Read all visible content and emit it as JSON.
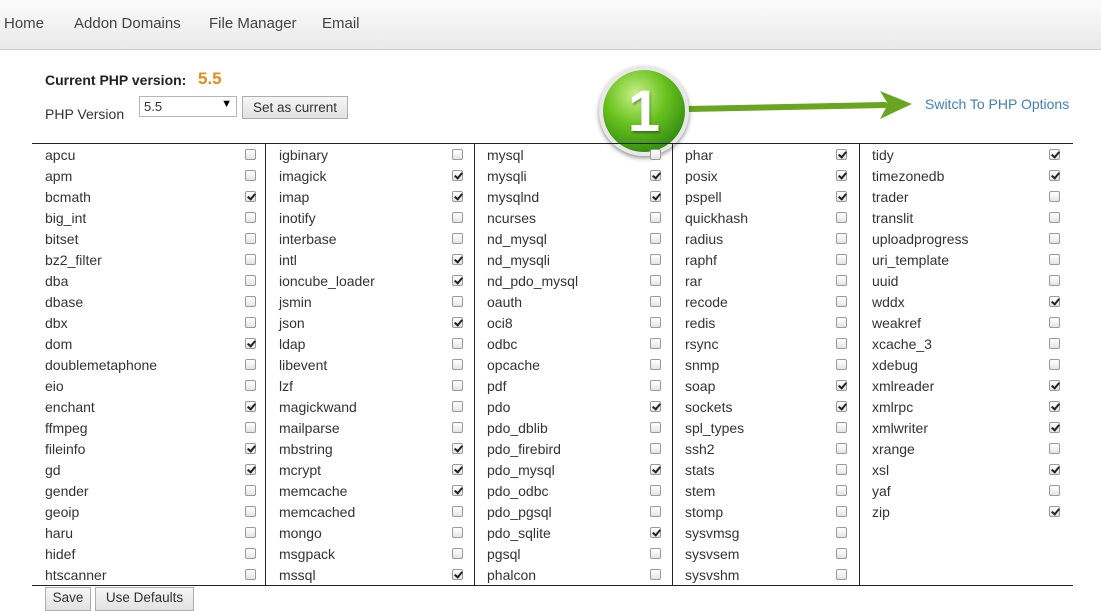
{
  "nav": {
    "items": [
      "Home",
      "Addon Domains",
      "File Manager",
      "Email"
    ]
  },
  "php": {
    "current_label": "Current PHP version:",
    "current_value": "5.5",
    "version_label": "PHP Version",
    "version_selected": "5.5",
    "set_current_label": "Set as current",
    "switch_link": "Switch To PHP Options",
    "annotation_badge": "1"
  },
  "colors": {
    "accent_orange": "#e98a1a",
    "link_blue": "#3d7fc0",
    "badge_green": "#6ac21e",
    "arrow_green": "#6aa521"
  },
  "columns": [
    [
      {
        "name": "apcu",
        "checked": false
      },
      {
        "name": "apm",
        "checked": false
      },
      {
        "name": "bcmath",
        "checked": true
      },
      {
        "name": "big_int",
        "checked": false
      },
      {
        "name": "bitset",
        "checked": false
      },
      {
        "name": "bz2_filter",
        "checked": false
      },
      {
        "name": "dba",
        "checked": false
      },
      {
        "name": "dbase",
        "checked": false
      },
      {
        "name": "dbx",
        "checked": false
      },
      {
        "name": "dom",
        "checked": true
      },
      {
        "name": "doublemetaphone",
        "checked": false
      },
      {
        "name": "eio",
        "checked": false
      },
      {
        "name": "enchant",
        "checked": true
      },
      {
        "name": "ffmpeg",
        "checked": false
      },
      {
        "name": "fileinfo",
        "checked": true
      },
      {
        "name": "gd",
        "checked": true
      },
      {
        "name": "gender",
        "checked": false
      },
      {
        "name": "geoip",
        "checked": false
      },
      {
        "name": "haru",
        "checked": false
      },
      {
        "name": "hidef",
        "checked": false
      },
      {
        "name": "htscanner",
        "checked": false
      }
    ],
    [
      {
        "name": "igbinary",
        "checked": false
      },
      {
        "name": "imagick",
        "checked": true
      },
      {
        "name": "imap",
        "checked": true
      },
      {
        "name": "inotify",
        "checked": false
      },
      {
        "name": "interbase",
        "checked": false
      },
      {
        "name": "intl",
        "checked": true
      },
      {
        "name": "ioncube_loader",
        "checked": true
      },
      {
        "name": "jsmin",
        "checked": false
      },
      {
        "name": "json",
        "checked": true
      },
      {
        "name": "ldap",
        "checked": false
      },
      {
        "name": "libevent",
        "checked": false
      },
      {
        "name": "lzf",
        "checked": false
      },
      {
        "name": "magickwand",
        "checked": false
      },
      {
        "name": "mailparse",
        "checked": false
      },
      {
        "name": "mbstring",
        "checked": true
      },
      {
        "name": "mcrypt",
        "checked": true
      },
      {
        "name": "memcache",
        "checked": true
      },
      {
        "name": "memcached",
        "checked": false
      },
      {
        "name": "mongo",
        "checked": false
      },
      {
        "name": "msgpack",
        "checked": false
      },
      {
        "name": "mssql",
        "checked": true
      }
    ],
    [
      {
        "name": "mysql",
        "checked": false
      },
      {
        "name": "mysqli",
        "checked": true
      },
      {
        "name": "mysqlnd",
        "checked": true
      },
      {
        "name": "ncurses",
        "checked": false
      },
      {
        "name": "nd_mysql",
        "checked": false
      },
      {
        "name": "nd_mysqli",
        "checked": false
      },
      {
        "name": "nd_pdo_mysql",
        "checked": false
      },
      {
        "name": "oauth",
        "checked": false
      },
      {
        "name": "oci8",
        "checked": false
      },
      {
        "name": "odbc",
        "checked": false
      },
      {
        "name": "opcache",
        "checked": false
      },
      {
        "name": "pdf",
        "checked": false
      },
      {
        "name": "pdo",
        "checked": true
      },
      {
        "name": "pdo_dblib",
        "checked": false
      },
      {
        "name": "pdo_firebird",
        "checked": false
      },
      {
        "name": "pdo_mysql",
        "checked": true
      },
      {
        "name": "pdo_odbc",
        "checked": false
      },
      {
        "name": "pdo_pgsql",
        "checked": false
      },
      {
        "name": "pdo_sqlite",
        "checked": true
      },
      {
        "name": "pgsql",
        "checked": false
      },
      {
        "name": "phalcon",
        "checked": false
      }
    ],
    [
      {
        "name": "phar",
        "checked": true
      },
      {
        "name": "posix",
        "checked": true
      },
      {
        "name": "pspell",
        "checked": true
      },
      {
        "name": "quickhash",
        "checked": false
      },
      {
        "name": "radius",
        "checked": false
      },
      {
        "name": "raphf",
        "checked": false
      },
      {
        "name": "rar",
        "checked": false
      },
      {
        "name": "recode",
        "checked": false
      },
      {
        "name": "redis",
        "checked": false
      },
      {
        "name": "rsync",
        "checked": false
      },
      {
        "name": "snmp",
        "checked": false
      },
      {
        "name": "soap",
        "checked": true
      },
      {
        "name": "sockets",
        "checked": true
      },
      {
        "name": "spl_types",
        "checked": false
      },
      {
        "name": "ssh2",
        "checked": false
      },
      {
        "name": "stats",
        "checked": false
      },
      {
        "name": "stem",
        "checked": false
      },
      {
        "name": "stomp",
        "checked": false
      },
      {
        "name": "sysvmsg",
        "checked": false
      },
      {
        "name": "sysvsem",
        "checked": false
      },
      {
        "name": "sysvshm",
        "checked": false
      }
    ],
    [
      {
        "name": "tidy",
        "checked": true
      },
      {
        "name": "timezonedb",
        "checked": true
      },
      {
        "name": "trader",
        "checked": false
      },
      {
        "name": "translit",
        "checked": false
      },
      {
        "name": "uploadprogress",
        "checked": false
      },
      {
        "name": "uri_template",
        "checked": false
      },
      {
        "name": "uuid",
        "checked": false
      },
      {
        "name": "wddx",
        "checked": true
      },
      {
        "name": "weakref",
        "checked": false
      },
      {
        "name": "xcache_3",
        "checked": false
      },
      {
        "name": "xdebug",
        "checked": false
      },
      {
        "name": "xmlreader",
        "checked": true
      },
      {
        "name": "xmlrpc",
        "checked": true
      },
      {
        "name": "xmlwriter",
        "checked": true
      },
      {
        "name": "xrange",
        "checked": false
      },
      {
        "name": "xsl",
        "checked": true
      },
      {
        "name": "yaf",
        "checked": false
      },
      {
        "name": "zip",
        "checked": true
      }
    ]
  ],
  "footer": {
    "save_label": "Save",
    "defaults_label": "Use Defaults"
  }
}
